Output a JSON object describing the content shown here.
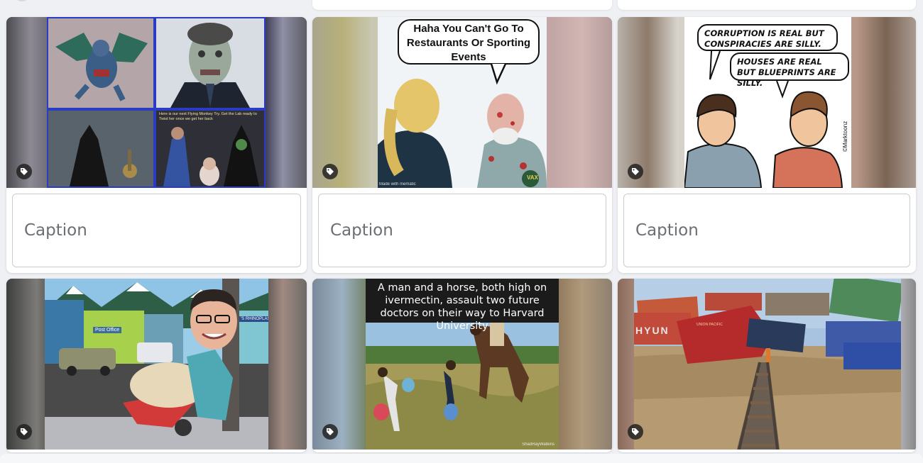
{
  "caption_placeholder": "Caption",
  "cards": [
    {
      "name": "card-flying-monkeys",
      "meme_text": "Here is our next Flying Monkey Try. Get the Lab ready to Twist her once we get her back"
    },
    {
      "name": "card-restaurants",
      "bubble_text": "Haha You Can't Go To Restaurants Or Sporting Events",
      "watermark": "Made with mematic",
      "badge": "VAX"
    },
    {
      "name": "card-corruption",
      "bubble1": "Corruption is real but conspiracies are silly.",
      "bubble2": "Houses are real but blueprints are silly.",
      "signature": "©Marktoonz"
    },
    {
      "name": "card-post-office",
      "sign_left": "Post Office",
      "sign_right": "'S RHINOPLASTY"
    },
    {
      "name": "card-horse",
      "overlay": "A man and a horse, both high on ivermectin, assault two future doctors on their way to Harvard University",
      "watermark": "ShadRayWatkins"
    },
    {
      "name": "card-train",
      "container_text": "HYUN",
      "engine_text": "UNION PACIFIC"
    }
  ],
  "colors": {
    "page_bg": "#eef0f3",
    "card_bg": "#ffffff",
    "caption_text": "#6b6f75",
    "border": "#c9ccd1"
  }
}
